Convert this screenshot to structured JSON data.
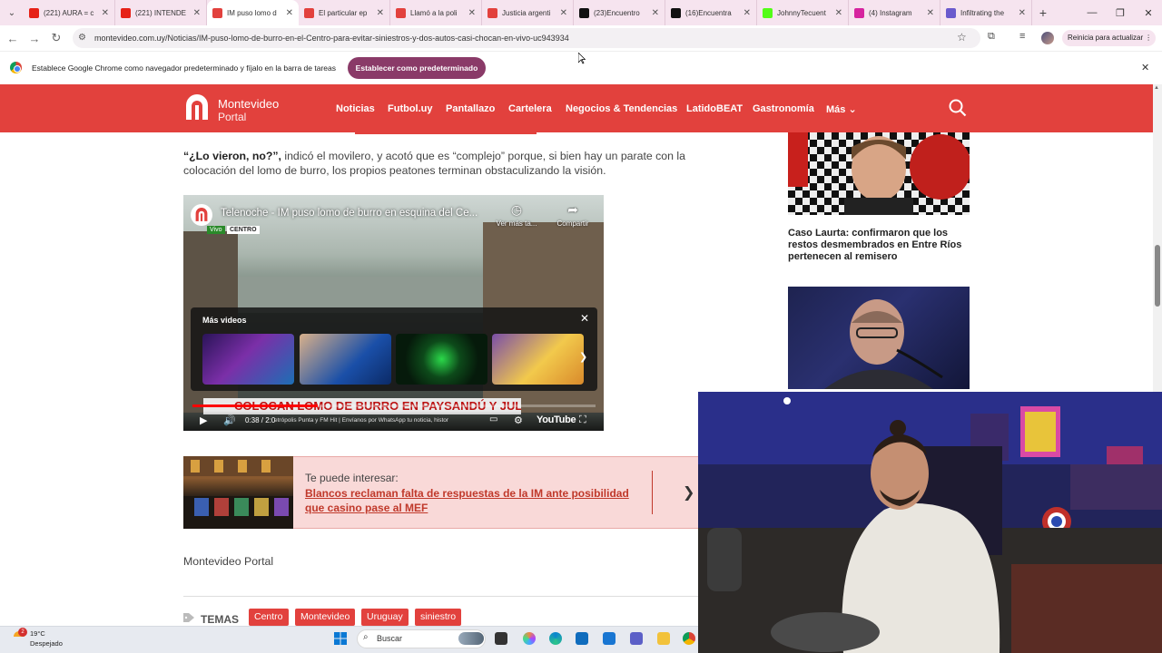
{
  "browser": {
    "tabs": [
      {
        "title": "(221) AURA = c",
        "favicon": "youtube-icon",
        "color": "#e62117"
      },
      {
        "title": "(221) INTENDE",
        "favicon": "youtube-icon",
        "color": "#e62117"
      },
      {
        "title": "IM puso lomo d",
        "favicon": "montevideo-portal-icon",
        "color": "#e2413d",
        "active": true
      },
      {
        "title": "El particular ep",
        "favicon": "montevideo-portal-icon",
        "color": "#e2413d"
      },
      {
        "title": "Llamó a la poli",
        "favicon": "montevideo-portal-icon",
        "color": "#e2413d"
      },
      {
        "title": "Justicia argenti",
        "favicon": "montevideo-portal-icon",
        "color": "#e2413d"
      },
      {
        "title": "(23)Encuentro",
        "favicon": "tiktok-icon",
        "color": "#111111"
      },
      {
        "title": "(16)Encuentra",
        "favicon": "tiktok-icon",
        "color": "#111111"
      },
      {
        "title": "JohnnyTecuent",
        "favicon": "kick-icon",
        "color": "#53fc18"
      },
      {
        "title": "(4) Instagram",
        "favicon": "instagram-icon",
        "color": "#d6249f"
      },
      {
        "title": "Infiltrating the",
        "favicon": "site-icon",
        "color": "#6a5acd"
      }
    ],
    "url": "montevideo.com.uy/Noticias/IM-puso-lomo-de-burro-en-el-Centro-para-evitar-siniestros-y-dos-autos-casi-chocan-en-vivo-uc943934",
    "update_button": "Reinicia para actualizar",
    "infobar": {
      "text": "Establece Google Chrome como navegador predeterminado y fíjalo en la barra de tareas",
      "button": "Establecer como predeterminado"
    }
  },
  "site": {
    "logo_line1": "Montevideo",
    "logo_line2": "Portal",
    "brand_color": "#e2413d",
    "nav": [
      "Noticias",
      "Futbol.uy",
      "Pantallazo",
      "Cartelera",
      "Negocios & Tendencias",
      "LatidoBEAT",
      "Gastronomía",
      "Más"
    ]
  },
  "article": {
    "quote": "“¿Lo vieron, no?”,",
    "paragraph_rest": " indicó el movilero, y acotó que es “complejo” porque, si bien hay un parate con la colocación del lomo de burro, los propios peatones terminan obstaculizando la visión.",
    "video": {
      "title": "Telenoche - IM puso lomo de burro en esquina del Ce...",
      "badge_live": "Vivo",
      "badge_location": "CENTRO",
      "watch_later": "Ver más ta...",
      "share": "Compartir",
      "more_videos": "Más videos",
      "lower_third": "COLOCAN LOMO DE BURRO EN PAYSANDÚ Y JULIO HERRERA",
      "time": "0:38 / 2:0",
      "ticker": "etrópolis Punta y FM Hit | Envíanos por WhatsApp tu noticia, histor",
      "brand": "YouTube",
      "progress": 0.31
    },
    "related": {
      "kicker": "Te puede interesar:",
      "title": "Blancos reclaman falta de respuestas de la IM ante posibilidad que casino pase al MEF"
    },
    "author": "Montevideo Portal",
    "tags_label": "TEMAS",
    "tags": [
      "Centro",
      "Montevideo",
      "Uruguay",
      "siniestro"
    ]
  },
  "sidebar": {
    "headline1": "Caso Laurta: confirmaron que los restos desmembrados en Entre Ríos pertenecen al remisero"
  },
  "taskbar": {
    "weather_temp": "19°C",
    "weather_desc": "Despejado",
    "weather_badge": "2",
    "search": "Buscar"
  }
}
